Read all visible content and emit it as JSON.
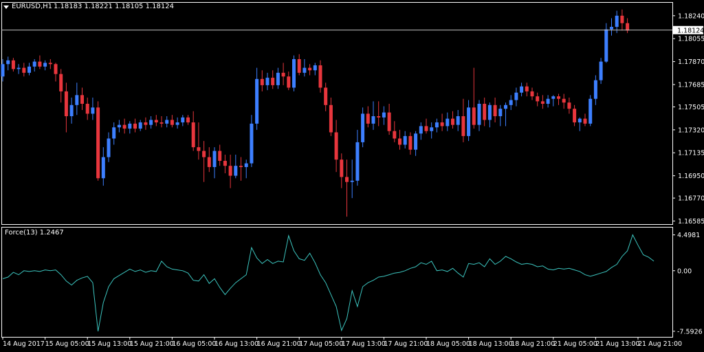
{
  "header": {
    "symbol": "EURUSD,H1",
    "ohlc": "1.18183 1.18221 1.18105 1.18124"
  },
  "indicator": {
    "label": "Force(13) 1.2467"
  },
  "colors": {
    "background": "#000000",
    "frame": "#ffffff",
    "bull": "#3d7fff",
    "bear": "#e8363d",
    "force_line": "#3cc6c0",
    "price_line": "#c8c8c8",
    "text": "#ffffff"
  },
  "chart_data": [
    {
      "type": "candlestick",
      "title": "EURUSD,H1",
      "current_price": 1.18124,
      "current_price_label": "1.18124",
      "ylim": [
        1.1656,
        1.1835
      ],
      "y_ticks": [
        1.1824,
        1.18055,
        1.1787,
        1.17685,
        1.17505,
        1.1732,
        1.17135,
        1.1695,
        1.1677,
        1.16585
      ],
      "y_tick_labels": [
        "1.18240",
        "1.18055",
        "1.17870",
        "1.17685",
        "1.17505",
        "1.17320",
        "1.17135",
        "1.16950",
        "1.16770",
        "1.16585"
      ],
      "ohlc": [
        [
          1.1775,
          1.1789,
          1.1771,
          1.1785
        ],
        [
          1.1785,
          1.1791,
          1.178,
          1.1788
        ],
        [
          1.1788,
          1.179,
          1.1779,
          1.1781
        ],
        [
          1.1781,
          1.1785,
          1.1777,
          1.1782
        ],
        [
          1.1782,
          1.1786,
          1.1775,
          1.1778
        ],
        [
          1.1778,
          1.1786,
          1.1776,
          1.1783
        ],
        [
          1.1783,
          1.1789,
          1.1779,
          1.1787
        ],
        [
          1.1787,
          1.1792,
          1.1781,
          1.1783
        ],
        [
          1.1783,
          1.1788,
          1.178,
          1.1786
        ],
        [
          1.1786,
          1.1789,
          1.1781,
          1.1785
        ],
        [
          1.1785,
          1.1786,
          1.1771,
          1.1777
        ],
        [
          1.1777,
          1.1781,
          1.1754,
          1.1763
        ],
        [
          1.1763,
          1.177,
          1.173,
          1.1743
        ],
        [
          1.1743,
          1.1758,
          1.1737,
          1.1752
        ],
        [
          1.1752,
          1.177,
          1.1744,
          1.176
        ],
        [
          1.176,
          1.1766,
          1.1748,
          1.1753
        ],
        [
          1.1753,
          1.1758,
          1.174,
          1.1745
        ],
        [
          1.1745,
          1.1758,
          1.174,
          1.175
        ],
        [
          1.175,
          1.1755,
          1.1691,
          1.1693
        ],
        [
          1.1693,
          1.1718,
          1.1687,
          1.171
        ],
        [
          1.171,
          1.173,
          1.1706,
          1.1725
        ],
        [
          1.1725,
          1.1738,
          1.172,
          1.1734
        ],
        [
          1.1734,
          1.174,
          1.173,
          1.1736
        ],
        [
          1.1736,
          1.1741,
          1.1729,
          1.1733
        ],
        [
          1.1733,
          1.1739,
          1.1729,
          1.1737
        ],
        [
          1.1737,
          1.1741,
          1.173,
          1.1733
        ],
        [
          1.1733,
          1.174,
          1.1731,
          1.1738
        ],
        [
          1.1738,
          1.1742,
          1.1732,
          1.1736
        ],
        [
          1.1736,
          1.1743,
          1.1733,
          1.174
        ],
        [
          1.174,
          1.1744,
          1.1735,
          1.1738
        ],
        [
          1.1738,
          1.1743,
          1.1734,
          1.1737
        ],
        [
          1.1737,
          1.1743,
          1.1734,
          1.174
        ],
        [
          1.174,
          1.1744,
          1.1734,
          1.1736
        ],
        [
          1.1736,
          1.1742,
          1.1733,
          1.1738
        ],
        [
          1.1738,
          1.1744,
          1.1735,
          1.1742
        ],
        [
          1.1742,
          1.1744,
          1.1736,
          1.1738
        ],
        [
          1.1738,
          1.1747,
          1.1715,
          1.1718
        ],
        [
          1.1718,
          1.1738,
          1.1708,
          1.1715
        ],
        [
          1.1715,
          1.1723,
          1.169,
          1.171
        ],
        [
          1.171,
          1.1718,
          1.1698,
          1.1702
        ],
        [
          1.1702,
          1.1718,
          1.1693,
          1.1715
        ],
        [
          1.1715,
          1.172,
          1.1703,
          1.1707
        ],
        [
          1.1707,
          1.1712,
          1.1697,
          1.1703
        ],
        [
          1.1703,
          1.1712,
          1.1685,
          1.1695
        ],
        [
          1.1695,
          1.1712,
          1.1693,
          1.1703
        ],
        [
          1.1703,
          1.171,
          1.1691,
          1.1702
        ],
        [
          1.1702,
          1.1708,
          1.1693,
          1.1705
        ],
        [
          1.1705,
          1.1744,
          1.1702,
          1.1737
        ],
        [
          1.1737,
          1.1782,
          1.1732,
          1.1773
        ],
        [
          1.1773,
          1.178,
          1.1763,
          1.1768
        ],
        [
          1.1768,
          1.1778,
          1.1764,
          1.1774
        ],
        [
          1.1774,
          1.178,
          1.1765,
          1.1768
        ],
        [
          1.1768,
          1.1782,
          1.1765,
          1.1778
        ],
        [
          1.1778,
          1.1786,
          1.1768,
          1.1775
        ],
        [
          1.1775,
          1.1779,
          1.1764,
          1.1766
        ],
        [
          1.1766,
          1.1792,
          1.1763,
          1.1789
        ],
        [
          1.1789,
          1.1793,
          1.1776,
          1.1778
        ],
        [
          1.1778,
          1.1789,
          1.1775,
          1.1782
        ],
        [
          1.1782,
          1.1785,
          1.1776,
          1.178
        ],
        [
          1.178,
          1.1786,
          1.1776,
          1.1784
        ],
        [
          1.1784,
          1.1788,
          1.1762,
          1.1766
        ],
        [
          1.1766,
          1.177,
          1.1747,
          1.1752
        ],
        [
          1.1752,
          1.1758,
          1.1727,
          1.173
        ],
        [
          1.173,
          1.174,
          1.1698,
          1.1708
        ],
        [
          1.1708,
          1.1713,
          1.1685,
          1.1694
        ],
        [
          1.1694,
          1.1708,
          1.1662,
          1.169
        ],
        [
          1.169,
          1.1708,
          1.1677,
          1.1691
        ],
        [
          1.1691,
          1.1732,
          1.1687,
          1.1722
        ],
        [
          1.1722,
          1.175,
          1.1718,
          1.1745
        ],
        [
          1.1745,
          1.1751,
          1.1734,
          1.1737
        ],
        [
          1.1737,
          1.1755,
          1.1732,
          1.1743
        ],
        [
          1.1743,
          1.1755,
          1.1735,
          1.1742
        ],
        [
          1.1742,
          1.1751,
          1.1736,
          1.1746
        ],
        [
          1.1746,
          1.1753,
          1.1728,
          1.1731
        ],
        [
          1.1731,
          1.1739,
          1.1722,
          1.1725
        ],
        [
          1.1725,
          1.1732,
          1.1716,
          1.172
        ],
        [
          1.172,
          1.1731,
          1.1717,
          1.1727
        ],
        [
          1.1727,
          1.173,
          1.1712,
          1.1716
        ],
        [
          1.1716,
          1.1731,
          1.1711,
          1.1729
        ],
        [
          1.1729,
          1.1738,
          1.1724,
          1.1735
        ],
        [
          1.1735,
          1.1741,
          1.1729,
          1.1731
        ],
        [
          1.1731,
          1.1738,
          1.1725,
          1.1734
        ],
        [
          1.1734,
          1.1741,
          1.173,
          1.1738
        ],
        [
          1.1738,
          1.1745,
          1.1731,
          1.1735
        ],
        [
          1.1735,
          1.1746,
          1.1731,
          1.1741
        ],
        [
          1.1741,
          1.1747,
          1.1733,
          1.1736
        ],
        [
          1.1736,
          1.1748,
          1.1731,
          1.1743
        ],
        [
          1.1743,
          1.1757,
          1.1722,
          1.1727
        ],
        [
          1.1727,
          1.1756,
          1.1723,
          1.175
        ],
        [
          1.175,
          1.1782,
          1.1733,
          1.1736
        ],
        [
          1.1736,
          1.1756,
          1.1731,
          1.1753
        ],
        [
          1.1753,
          1.1758,
          1.1735,
          1.174
        ],
        [
          1.174,
          1.1754,
          1.1734,
          1.1752
        ],
        [
          1.1752,
          1.1758,
          1.1738,
          1.1743
        ],
        [
          1.1743,
          1.1752,
          1.1735,
          1.1749
        ],
        [
          1.1749,
          1.1754,
          1.1735,
          1.1752
        ],
        [
          1.1752,
          1.176,
          1.1748,
          1.1756
        ],
        [
          1.1756,
          1.1766,
          1.1751,
          1.1762
        ],
        [
          1.1762,
          1.177,
          1.1759,
          1.1767
        ],
        [
          1.1767,
          1.177,
          1.1759,
          1.1763
        ],
        [
          1.1763,
          1.1766,
          1.1756,
          1.1759
        ],
        [
          1.1759,
          1.1762,
          1.1751,
          1.1755
        ],
        [
          1.1755,
          1.176,
          1.1749,
          1.1753
        ],
        [
          1.1753,
          1.176,
          1.175,
          1.1757
        ],
        [
          1.1757,
          1.176,
          1.1751,
          1.1759
        ],
        [
          1.1759,
          1.1761,
          1.1752,
          1.1757
        ],
        [
          1.1757,
          1.1761,
          1.1749,
          1.1754
        ],
        [
          1.1754,
          1.1758,
          1.1745,
          1.1749
        ],
        [
          1.1749,
          1.1752,
          1.1735,
          1.1738
        ],
        [
          1.1738,
          1.1742,
          1.1731,
          1.1741
        ],
        [
          1.1741,
          1.1745,
          1.1735,
          1.1737
        ],
        [
          1.1737,
          1.176,
          1.1735,
          1.1757
        ],
        [
          1.1757,
          1.1776,
          1.1752,
          1.1772
        ],
        [
          1.1772,
          1.179,
          1.1769,
          1.1787
        ],
        [
          1.1787,
          1.1818,
          1.1786,
          1.1813
        ],
        [
          1.1813,
          1.1822,
          1.1808,
          1.1815
        ],
        [
          1.1815,
          1.1828,
          1.181,
          1.1824
        ],
        [
          1.1824,
          1.1829,
          1.1812,
          1.1818
        ],
        [
          1.1818,
          1.1822,
          1.181,
          1.1812
        ]
      ],
      "x_tick_labels": [
        "14 Aug 2017",
        "15 Aug 05:00",
        "15 Aug 13:00",
        "15 Aug 21:00",
        "16 Aug 05:00",
        "16 Aug 13:00",
        "16 Aug 21:00",
        "17 Aug 05:00",
        "17 Aug 13:00",
        "17 Aug 21:00",
        "18 Aug 05:00",
        "18 Aug 13:00",
        "18 Aug 21:00",
        "21 Aug 05:00",
        "21 Aug 13:00",
        "21 Aug 21:00"
      ],
      "x_tick_bar_index": [
        0,
        8,
        16,
        24,
        32,
        40,
        48,
        56,
        64,
        72,
        80,
        88,
        96,
        104,
        112,
        120
      ]
    },
    {
      "type": "line",
      "title": "Force(13) 1.2467",
      "ylim": [
        -8.3,
        5.5
      ],
      "y_ticks": [
        4.4981,
        0.0,
        -7.5926
      ],
      "y_tick_labels": [
        "4.4981",
        "0.00",
        "-7.5926"
      ],
      "series": [
        {
          "values": [
            -1.0,
            -0.8,
            -0.2,
            -0.5,
            0.0,
            -0.1,
            0.0,
            -0.1,
            0.1,
            0.0,
            0.1,
            -0.5,
            -1.3,
            -1.8,
            -1.2,
            -0.9,
            -0.7,
            -1.5,
            -7.6,
            -4.0,
            -2.0,
            -1.0,
            -0.6,
            -0.2,
            0.2,
            -0.1,
            0.1,
            -0.2,
            0.0,
            -0.1,
            1.2,
            0.5,
            0.2,
            0.1,
            0.0,
            -0.3,
            -1.2,
            -1.3,
            -0.5,
            -1.6,
            -1.0,
            -2.1,
            -3.0,
            -2.2,
            -1.5,
            -1.0,
            -0.5,
            2.9,
            1.6,
            0.9,
            1.4,
            0.9,
            1.2,
            1.1,
            4.4,
            2.5,
            1.5,
            1.3,
            2.2,
            1.0,
            -0.5,
            -1.5,
            -3.0,
            -4.5,
            -7.5,
            -6.0,
            -2.5,
            -4.5,
            -2.0,
            -1.5,
            -1.2,
            -0.8,
            -0.7,
            -0.5,
            -0.3,
            -0.2,
            0.0,
            0.3,
            0.5,
            1.0,
            0.8,
            1.2,
            0.0,
            0.1,
            -0.1,
            0.3,
            -0.3,
            -0.8,
            0.9,
            0.8,
            1.0,
            0.5,
            1.5,
            0.8,
            1.2,
            1.8,
            1.5,
            1.1,
            0.8,
            0.9,
            0.8,
            0.5,
            0.6,
            0.2,
            0.1,
            0.3,
            0.2,
            0.3,
            0.1,
            -0.1,
            -0.5,
            -0.7,
            -0.5,
            -0.3,
            -0.1,
            0.4,
            0.8,
            1.8,
            2.5,
            4.5,
            3.2,
            2.0,
            1.7,
            1.2
          ]
        }
      ]
    }
  ]
}
